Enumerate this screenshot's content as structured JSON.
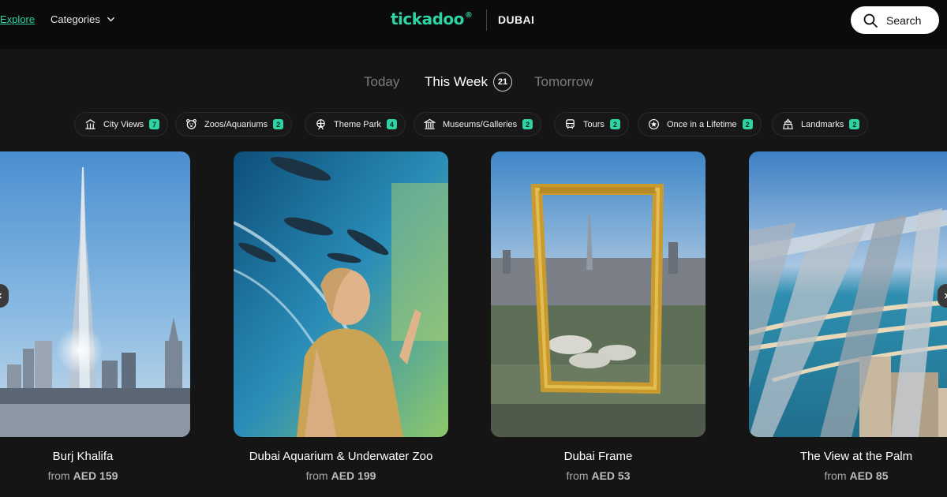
{
  "nav": {
    "explore": "Explore",
    "categories": "Categories",
    "brand": "tickadoo",
    "brand_mark": "®",
    "city": "DUBAI",
    "search": "Search"
  },
  "colors": {
    "accent": "#2ed3a3",
    "background": "#151515",
    "topbar": "#0b0b0b"
  },
  "day_tabs": {
    "today": "Today",
    "this_week": "This Week",
    "this_week_count": "21",
    "tomorrow": "Tomorrow",
    "active": "This Week"
  },
  "categories": [
    {
      "label": "City Views",
      "count": "7",
      "icon": "city-views-icon"
    },
    {
      "label": "Zoos/Aquariums",
      "count": "2",
      "icon": "zoo-icon"
    },
    {
      "label": "Theme Park",
      "count": "4",
      "icon": "theme-park-icon"
    },
    {
      "label": "Museums/Galleries",
      "count": "2",
      "icon": "museum-icon"
    },
    {
      "label": "Tours",
      "count": "2",
      "icon": "bus-icon"
    },
    {
      "label": "Once in a Lifetime",
      "count": "2",
      "icon": "star-icon"
    },
    {
      "label": "Landmarks",
      "count": "2",
      "icon": "landmark-icon"
    }
  ],
  "cards": [
    {
      "title": "Burj Khalifa",
      "from": "from",
      "price": "AED 159"
    },
    {
      "title": "Dubai Aquarium & Underwater Zoo",
      "from": "from",
      "price": "AED 199"
    },
    {
      "title": "Dubai Frame",
      "from": "from",
      "price": "AED 53"
    },
    {
      "title": "The View at the Palm",
      "from": "from",
      "price": "AED 85"
    }
  ]
}
